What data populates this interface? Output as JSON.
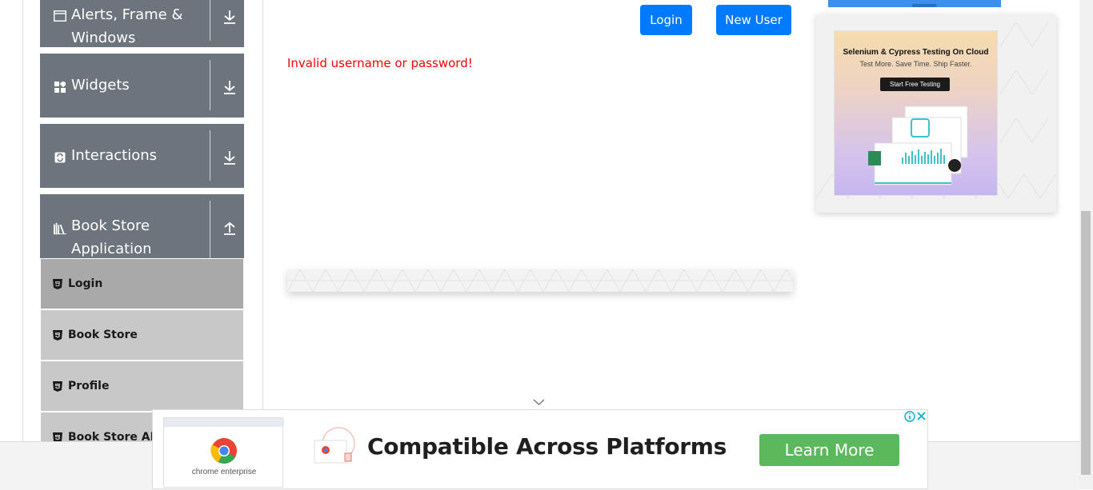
{
  "sidebar": {
    "groups": [
      {
        "label": "Alerts, Frame & Windows",
        "icon": "window-icon",
        "state": "collapsed"
      },
      {
        "label": "Widgets",
        "icon": "widgets-icon",
        "state": "collapsed"
      },
      {
        "label": "Interactions",
        "icon": "interactions-icon",
        "state": "collapsed"
      },
      {
        "label": "Book Store Application",
        "icon": "books-icon",
        "state": "expanded"
      }
    ],
    "book_store_items": [
      {
        "label": "Login",
        "icon": "html5-icon",
        "active": true
      },
      {
        "label": "Book Store",
        "icon": "html5-icon",
        "active": false
      },
      {
        "label": "Profile",
        "icon": "html5-icon",
        "active": false
      },
      {
        "label": "Book Store API",
        "icon": "html5-icon",
        "active": false
      }
    ]
  },
  "main": {
    "login_button": "Login",
    "new_user_button": "New User",
    "error_message": "Invalid username or password!"
  },
  "side_ad": {
    "title": "Selenium & Cypress Testing On Cloud",
    "subtitle": "Test More. Save Time. Ship Faster.",
    "cta": "Start Free Testing"
  },
  "bottom_ad": {
    "product_caption": "chrome enterprise",
    "headline": "Compatible Across Platforms",
    "cta": "Learn More"
  },
  "colors": {
    "sidebar_header": "#6c757d",
    "menu_item": "#c8c8c8",
    "menu_item_active": "#a9a9a9",
    "primary": "#007bff",
    "error": "#ff0000",
    "cta_green": "#5cb85c"
  }
}
